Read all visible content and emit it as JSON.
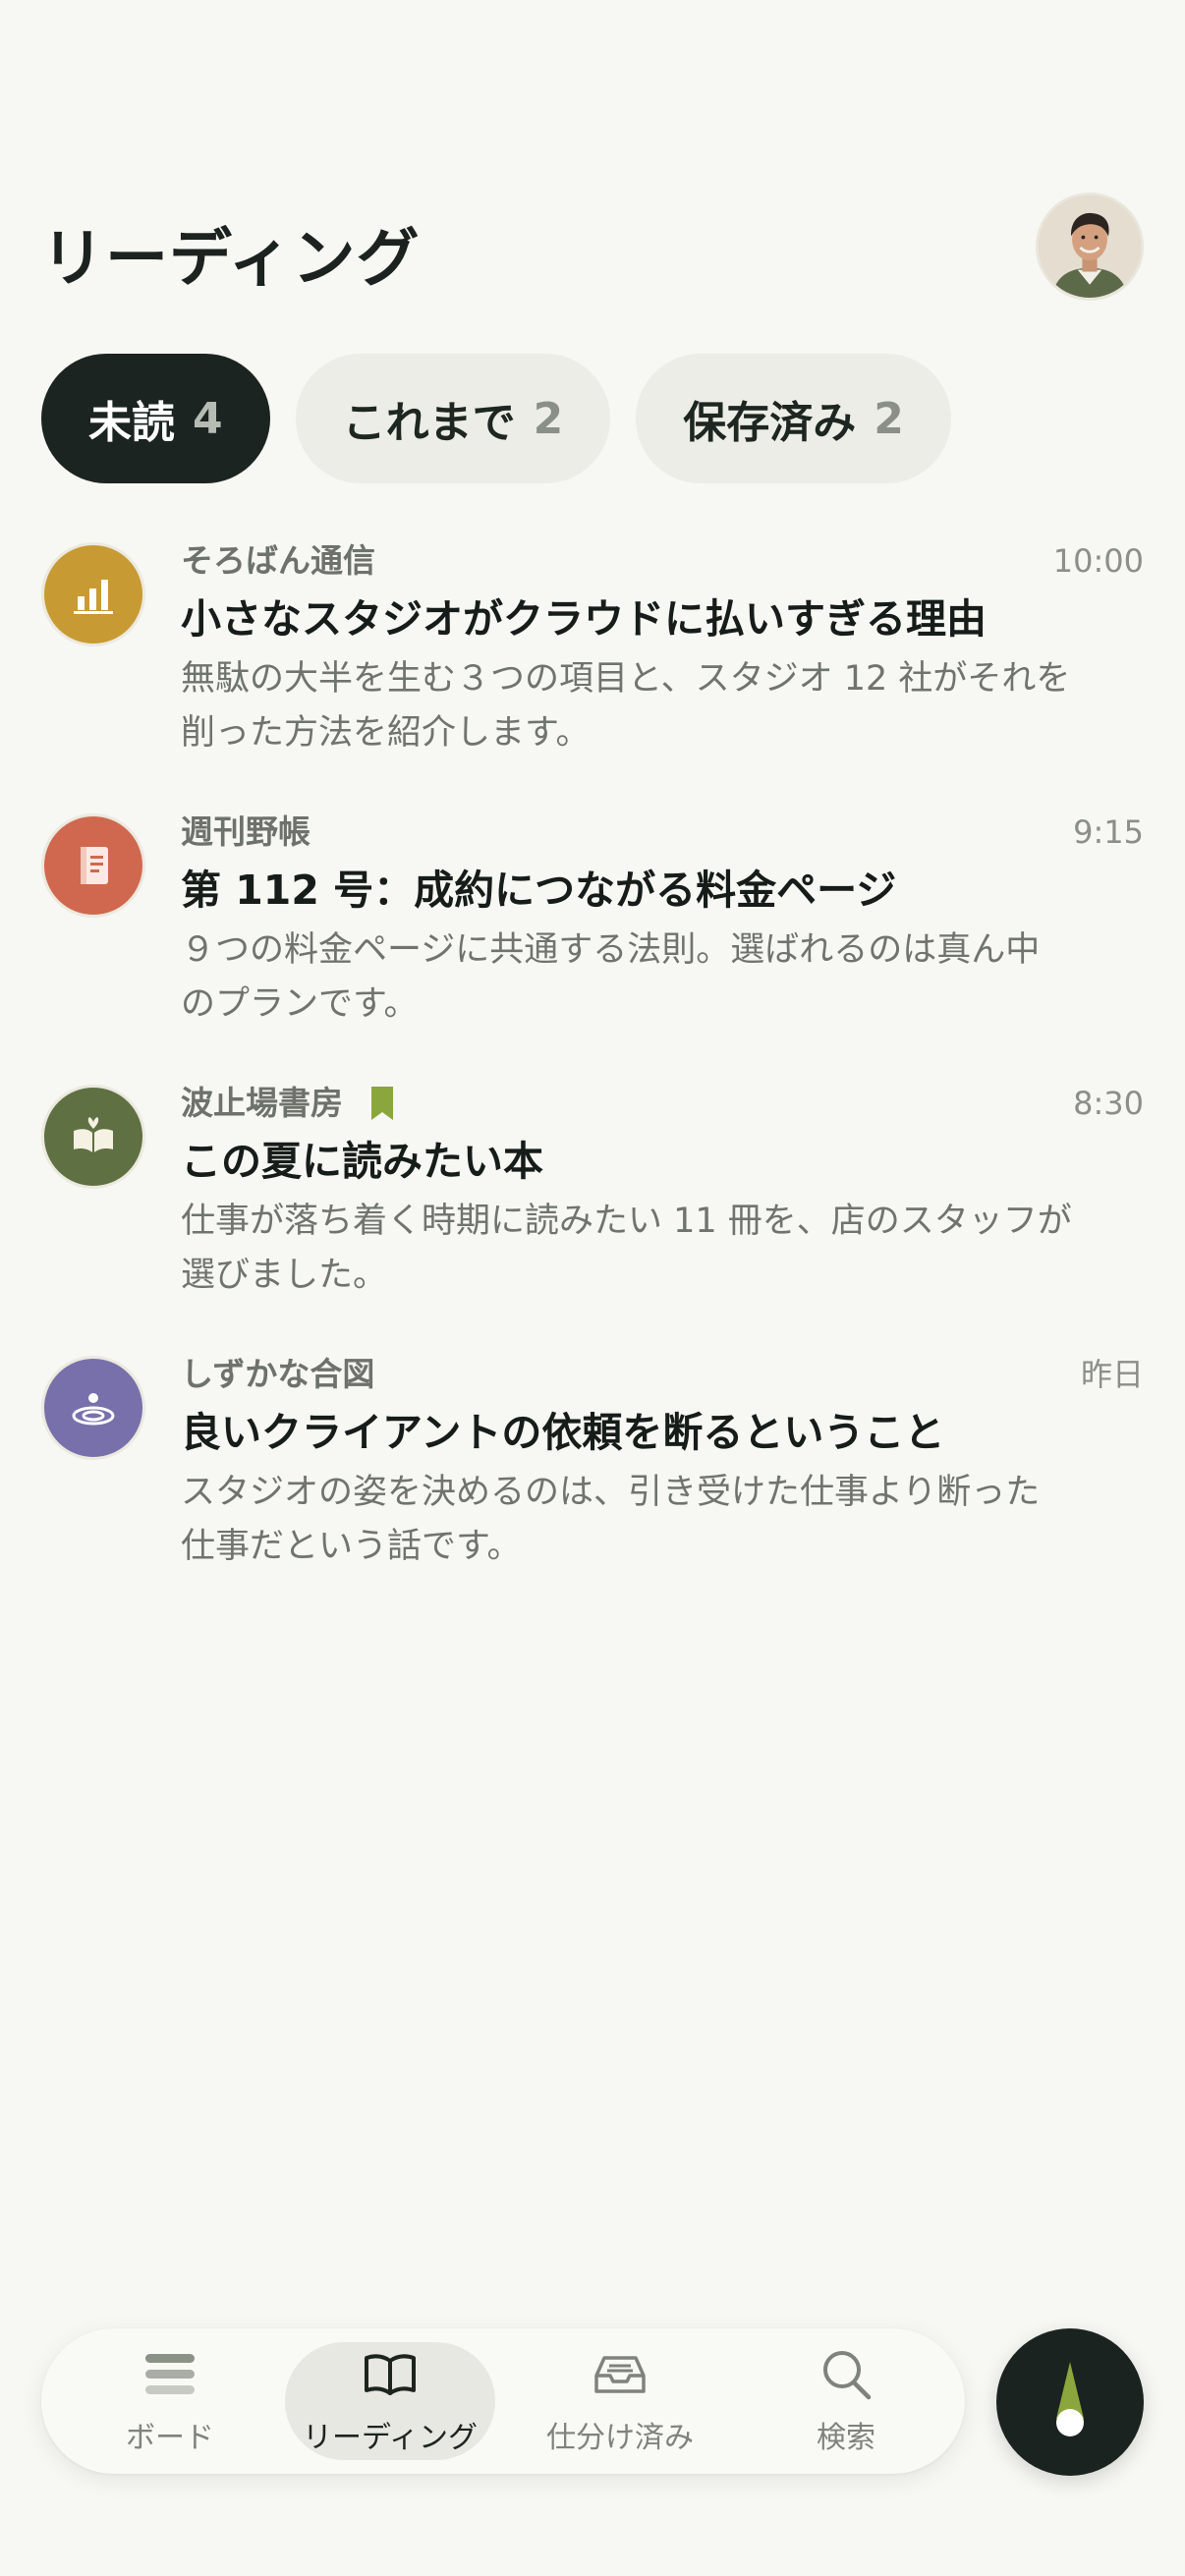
{
  "header": {
    "title": "リーディング",
    "avatar_icon": "user-avatar"
  },
  "tabs": [
    {
      "label": "未読",
      "count": "4",
      "active": true
    },
    {
      "label": "これまで",
      "count": "2",
      "active": false
    },
    {
      "label": "保存済み",
      "count": "2",
      "active": false
    }
  ],
  "feed": [
    {
      "source": "そろばん通信",
      "time": "10:00",
      "title": "小さなスタジオがクラウドに払いすぎる理由",
      "excerpt_lines": [
        "無駄の大半を生む３つの項目と、スタジオ 12 社がそれを",
        "削った方法を紹介します。"
      ],
      "icon": "bar-chart-icon",
      "color": "#c89a33"
    },
    {
      "source": "週刊野帳",
      "time": "9:15",
      "title": "第 112 号：成約につながる料金ページ",
      "excerpt_lines": [
        "９つの料金ページに共通する法則。選ばれるのは真ん中",
        "のプランです。"
      ],
      "icon": "notebook-icon",
      "color": "#d0684f"
    },
    {
      "source": "波止場書房",
      "time": "8:30",
      "title": "この夏に読みたい本",
      "excerpt_lines": [
        "仕事が落ち着く時期に読みたい 11 冊を、店のスタッフが",
        "選びました。"
      ],
      "icon": "open-book-sprout-icon",
      "color": "#5f7042",
      "bookmarked": true
    },
    {
      "source": "しずかな合図",
      "time": "昨日",
      "title": "良いクライアントの依頼を断るということ",
      "excerpt_lines": [
        "スタジオの姿を決めるのは、引き受けた仕事より断った",
        "仕事だという話です。"
      ],
      "icon": "ripple-icon",
      "color": "#7870ab"
    }
  ],
  "bottom_nav": [
    {
      "label": "ボード",
      "icon": "stack-icon",
      "active": false
    },
    {
      "label": "リーディング",
      "icon": "book-icon",
      "active": true
    },
    {
      "label": "仕分け済み",
      "icon": "inbox-icon",
      "active": false
    },
    {
      "label": "検索",
      "icon": "search-icon",
      "active": false
    }
  ],
  "compass_button": {
    "icon": "compass-icon",
    "color": "#1a231f"
  },
  "colors": {
    "background": "#f7f7f3",
    "active_tab": "#1b2420",
    "bookmark": "#8aa63c"
  }
}
